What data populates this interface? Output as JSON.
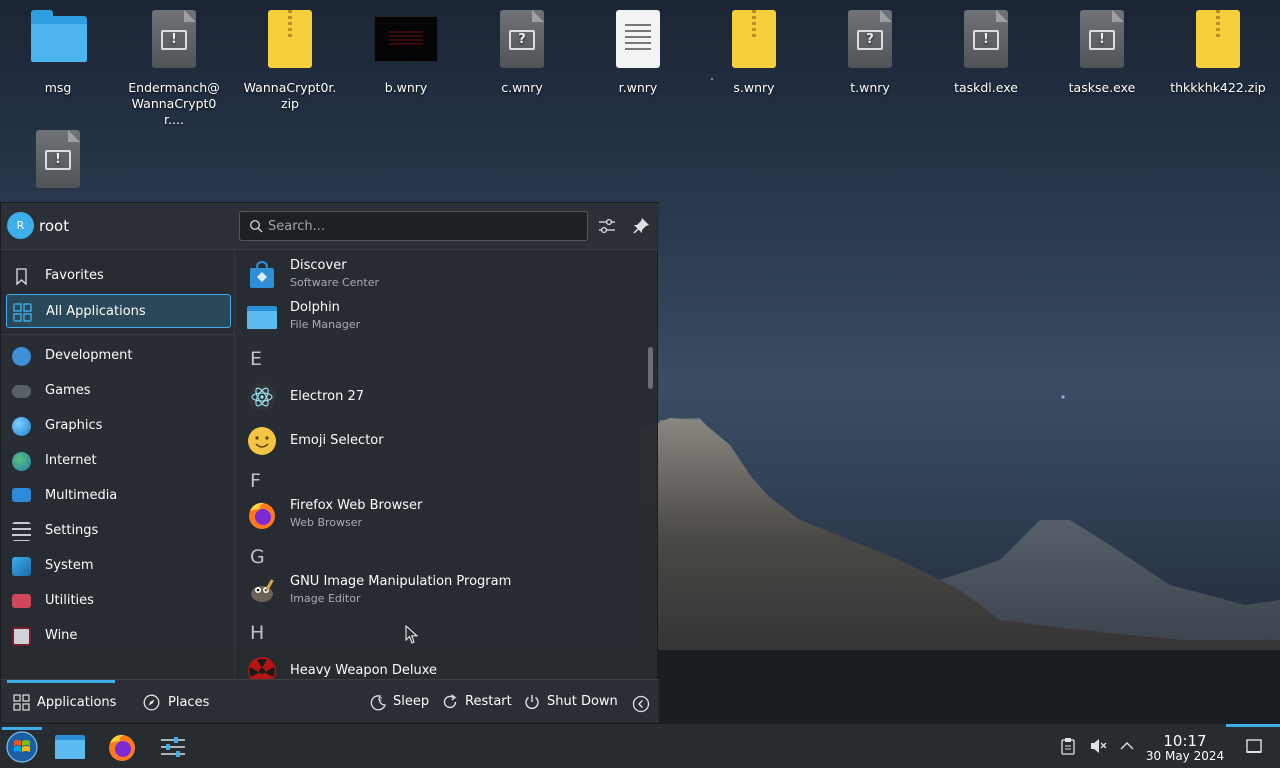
{
  "desktop": {
    "icons": [
      {
        "label": "msg",
        "icon": "folder-icon"
      },
      {
        "label": "Endermanch@\nWannaCrypt0r....",
        "icon": "executable-icon"
      },
      {
        "label": "WannaCrypt0r.\nzip",
        "icon": "zip-icon"
      },
      {
        "label": "b.wnry",
        "icon": "image-file-icon"
      },
      {
        "label": "c.wnry",
        "icon": "unknown-file-icon"
      },
      {
        "label": "r.wnry",
        "icon": "text-file-icon"
      },
      {
        "label": "s.wnry",
        "icon": "zip-icon"
      },
      {
        "label": "t.wnry",
        "icon": "unknown-file-icon"
      },
      {
        "label": "taskdl.exe",
        "icon": "executable-icon"
      },
      {
        "label": "taskse.exe",
        "icon": "executable-icon"
      },
      {
        "label": "thkkkhk422.zip",
        "icon": "zip-icon"
      },
      {
        "label": "",
        "icon": "executable-icon"
      }
    ]
  },
  "launcher": {
    "user": {
      "initial": "R",
      "name": "root"
    },
    "search": {
      "placeholder": "Search..."
    },
    "header_buttons": [
      "configure-icon",
      "pin-icon"
    ],
    "categories": [
      {
        "label": "Favorites",
        "icon": "bookmark-icon",
        "active": false
      },
      {
        "label": "All Applications",
        "icon": "all-apps-icon",
        "active": true
      },
      {
        "label": "Development",
        "icon": "development-icon",
        "active": false
      },
      {
        "label": "Games",
        "icon": "gamepad-icon",
        "active": false
      },
      {
        "label": "Graphics",
        "icon": "graphics-icon",
        "active": false
      },
      {
        "label": "Internet",
        "icon": "globe-icon",
        "active": false
      },
      {
        "label": "Multimedia",
        "icon": "multimedia-icon",
        "active": false
      },
      {
        "label": "Settings",
        "icon": "settings-icon",
        "active": false
      },
      {
        "label": "System",
        "icon": "system-icon",
        "active": false
      },
      {
        "label": "Utilities",
        "icon": "utilities-icon",
        "active": false
      },
      {
        "label": "Wine",
        "icon": "wine-icon",
        "active": false
      }
    ],
    "apps": [
      {
        "name": "Discover",
        "subtitle": "Software Center",
        "icon": "discover-icon"
      },
      {
        "name": "Dolphin",
        "subtitle": "File Manager",
        "icon": "dolphin-icon"
      },
      {
        "letter": "E"
      },
      {
        "name": "Electron 27",
        "subtitle": "",
        "icon": "electron-icon"
      },
      {
        "name": "Emoji Selector",
        "subtitle": "",
        "icon": "emoji-icon"
      },
      {
        "letter": "F"
      },
      {
        "name": "Firefox Web Browser",
        "subtitle": "Web Browser",
        "icon": "firefox-icon"
      },
      {
        "letter": "G"
      },
      {
        "name": "GNU Image Manipulation Program",
        "subtitle": "Image Editor",
        "icon": "gimp-icon"
      },
      {
        "letter": "H"
      },
      {
        "name": "Heavy Weapon Deluxe",
        "subtitle": "",
        "icon": "heavy-weapon-icon"
      }
    ],
    "footer": {
      "tabs": [
        {
          "label": "Applications",
          "icon": "applications-grid-icon",
          "active": true
        },
        {
          "label": "Places",
          "icon": "compass-icon",
          "active": false
        }
      ],
      "power": [
        {
          "label": "Sleep",
          "icon": "sleep-icon"
        },
        {
          "label": "Restart",
          "icon": "restart-icon"
        },
        {
          "label": "Shut Down",
          "icon": "shutdown-icon"
        }
      ],
      "more_icon": "chevron-left-icon"
    }
  },
  "taskbar": {
    "items": [
      "start-menu-icon",
      "file-manager-icon",
      "firefox-icon",
      "system-settings-icon"
    ],
    "tray": [
      "clipboard-icon",
      "volume-muted-icon",
      "chevron-up-icon"
    ],
    "clock": {
      "time": "10:17",
      "date": "30 May 2024"
    },
    "show_desktop_icon": "show-desktop-icon"
  },
  "colors": {
    "accent": "#3daee9",
    "panel": "#272c31",
    "launcher": "#2a2e33"
  }
}
